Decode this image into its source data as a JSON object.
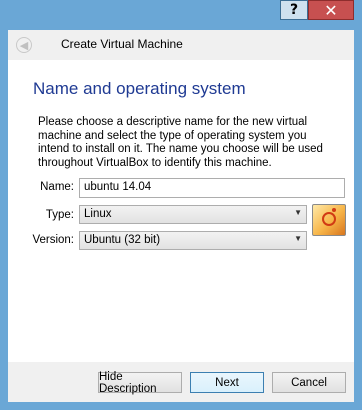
{
  "titlebar": {
    "help_label": "?",
    "close_label": "✕"
  },
  "header": {
    "title": "Create Virtual Machine",
    "back_icon": "back-arrow-icon"
  },
  "page": {
    "heading": "Name and operating system",
    "description": "Please choose a descriptive name for the new virtual machine and select the type of operating system you intend to install on it. The name you choose will be used throughout VirtualBox to identify this machine."
  },
  "form": {
    "name_label": "Name:",
    "name_value": "ubuntu 14.04",
    "type_label": "Type:",
    "type_value": "Linux",
    "version_label": "Version:",
    "version_value": "Ubuntu (32 bit)",
    "os_icon": "ubuntu-icon"
  },
  "buttons": {
    "hide_description": "Hide Description",
    "next": "Next",
    "cancel": "Cancel"
  }
}
